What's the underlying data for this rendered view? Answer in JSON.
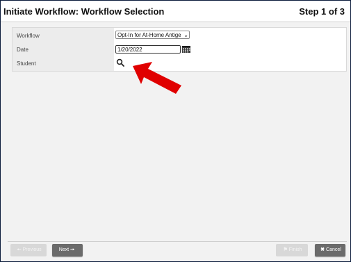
{
  "header": {
    "title": "Initiate Workflow: Workflow Selection",
    "step": "Step 1 of 3"
  },
  "form": {
    "workflow_label": "Workflow",
    "workflow_value": "Opt-In for At-Home Antige",
    "date_label": "Date",
    "date_value": "1/20/2022",
    "student_label": "Student"
  },
  "footer": {
    "previous_label": "Previous",
    "next_label": "Next",
    "finish_label": "Finish",
    "cancel_label": "Cancel"
  },
  "icons": {
    "search": "search-icon",
    "calendar": "calendar-icon",
    "annotation": "red-arrow-icon"
  },
  "colors": {
    "annotation_arrow": "#e00000",
    "active_button": "#6b6b6b",
    "disabled_button": "#d8d8d8",
    "frame_border": "#0a1a3a"
  }
}
